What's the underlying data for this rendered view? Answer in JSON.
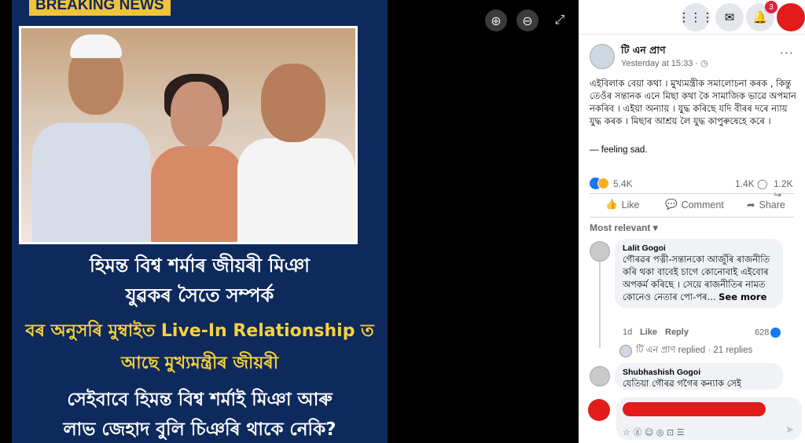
{
  "viewer": {
    "banner_label": "BREAKING NEWS",
    "headline_lines": [
      "হিমন্ত বিশ্ব শৰ্মাৰ জীয়ৰী মিঞা",
      "যুৱকৰ সৈতে সম্পৰ্ক",
      "বৰ অনুসৰি মুম্বাইত Live-In Relationship ত",
      "আছে মুখ্যমন্ত্ৰীৰ জীয়ৰী",
      "সেইবাবে হিমন্ত বিশ্ব শৰ্মাই মিঞা আৰু",
      "লাভ জেহাদ বুলি চিঞৰি থাকে নেকি?"
    ],
    "colors": {
      "poster_bg": "#0e2a5c",
      "accent_yellow": "#f7d23b"
    },
    "zoom_in_icon": "⊕",
    "zoom_out_icon": "⊖",
    "fullscreen_icon": "⤢"
  },
  "topbar": {
    "menu_icon": "⋮⋮⋮",
    "messenger_icon": "✉",
    "bell_icon": "🔔",
    "notification_count": "3"
  },
  "post": {
    "author": "টি এন প্ৰাণ",
    "time": "Yesterday at 15:33 · ◷",
    "more": "···",
    "text": "এইবিলাক বেয়া কথা । মুখ্যমন্ত্ৰীক সমালোচনা কৰক , কিন্তু তেওঁৰ সন্তানক এনে মিছা কথা কৈ সামাজিক ভাৱে অপমান নকৰিব । এইয়া অন্যায় । যুদ্ধ কৰিছে যদি বীৰৰ দৰে ন্যায় যুদ্ধ কৰক । মিছাৰ আশ্ৰয় লৈ যুদ্ধ কাপুৰুষেহে কৰে ।",
    "feeling": "— feeling sad.",
    "reactions": "5.4K",
    "comments": "1.4K ◯",
    "shares": "1.2K ↪",
    "actions": {
      "like": "Like",
      "comment": "Comment",
      "share": "Share"
    },
    "action_icons": {
      "like": "👍",
      "comment": "💬",
      "share": "➦"
    }
  },
  "comments": {
    "sort_label": "Most relevant ▾",
    "items": [
      {
        "name": "Lalit Gogoi",
        "text": "গৌৰৱৰ পত্নী-সন্তানকো আজুঁৰি ৰাজনীতি কৰি থকা বাবেই চাগে কোনোবাই এইবোৰ অপকৰ্ম কৰিছে । সেয়ে ৰাজনীতিৰ নামত কোনেও নেতাৰ পো-পৰ...",
        "see_more": "See more",
        "age": "1d",
        "like": "Like",
        "reply": "Reply",
        "reaction_count": "628"
      },
      {
        "name": "Shubhashish Gogoi",
        "text": "যেতিয়া গৌৰৱ গগৈৰ কন্যাক সেই"
      }
    ],
    "replies_label": "টি এন প্ৰাণ replied · 21 replies"
  },
  "composer": {
    "tool_icons": "☆  ⓖ  ☺  ◎  ⊡  ☰",
    "send_icon": "➤"
  }
}
